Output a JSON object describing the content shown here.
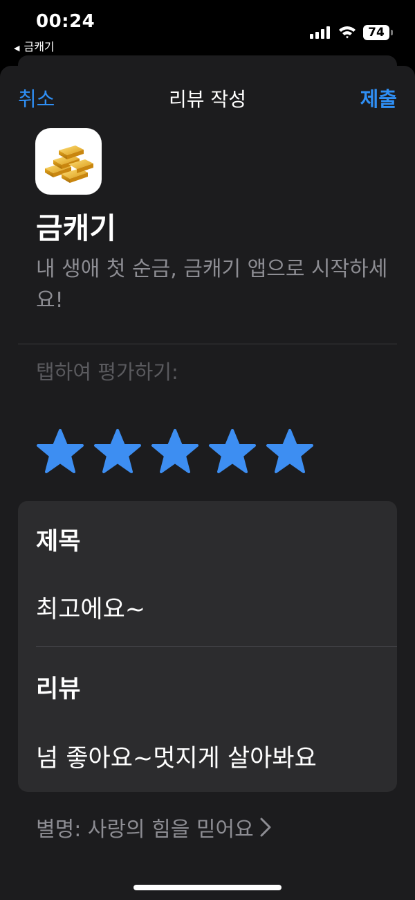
{
  "status_bar": {
    "time": "00:24",
    "back_app_label": "금캐기",
    "battery": "74"
  },
  "nav": {
    "cancel_label": "취소",
    "title": "리뷰 작성",
    "submit_label": "제출",
    "accent_color": "#2f8ff5"
  },
  "app": {
    "icon": "gold-bars-icon",
    "name": "금캐기",
    "subtitle": "내 생애 첫 순금, 금캐기 앱으로 시작하세요!"
  },
  "rating": {
    "hint": "탭하여 평가하기:",
    "value": 5,
    "max": 5,
    "star_color": "#3d8ef2"
  },
  "form": {
    "title_label": "제목",
    "title_value": "최고에요~",
    "review_label": "리뷰",
    "review_value": "넘 좋아요~멋지게 살아봐요"
  },
  "nickname": {
    "text": "별명: 사랑의 힘을 믿어요"
  }
}
